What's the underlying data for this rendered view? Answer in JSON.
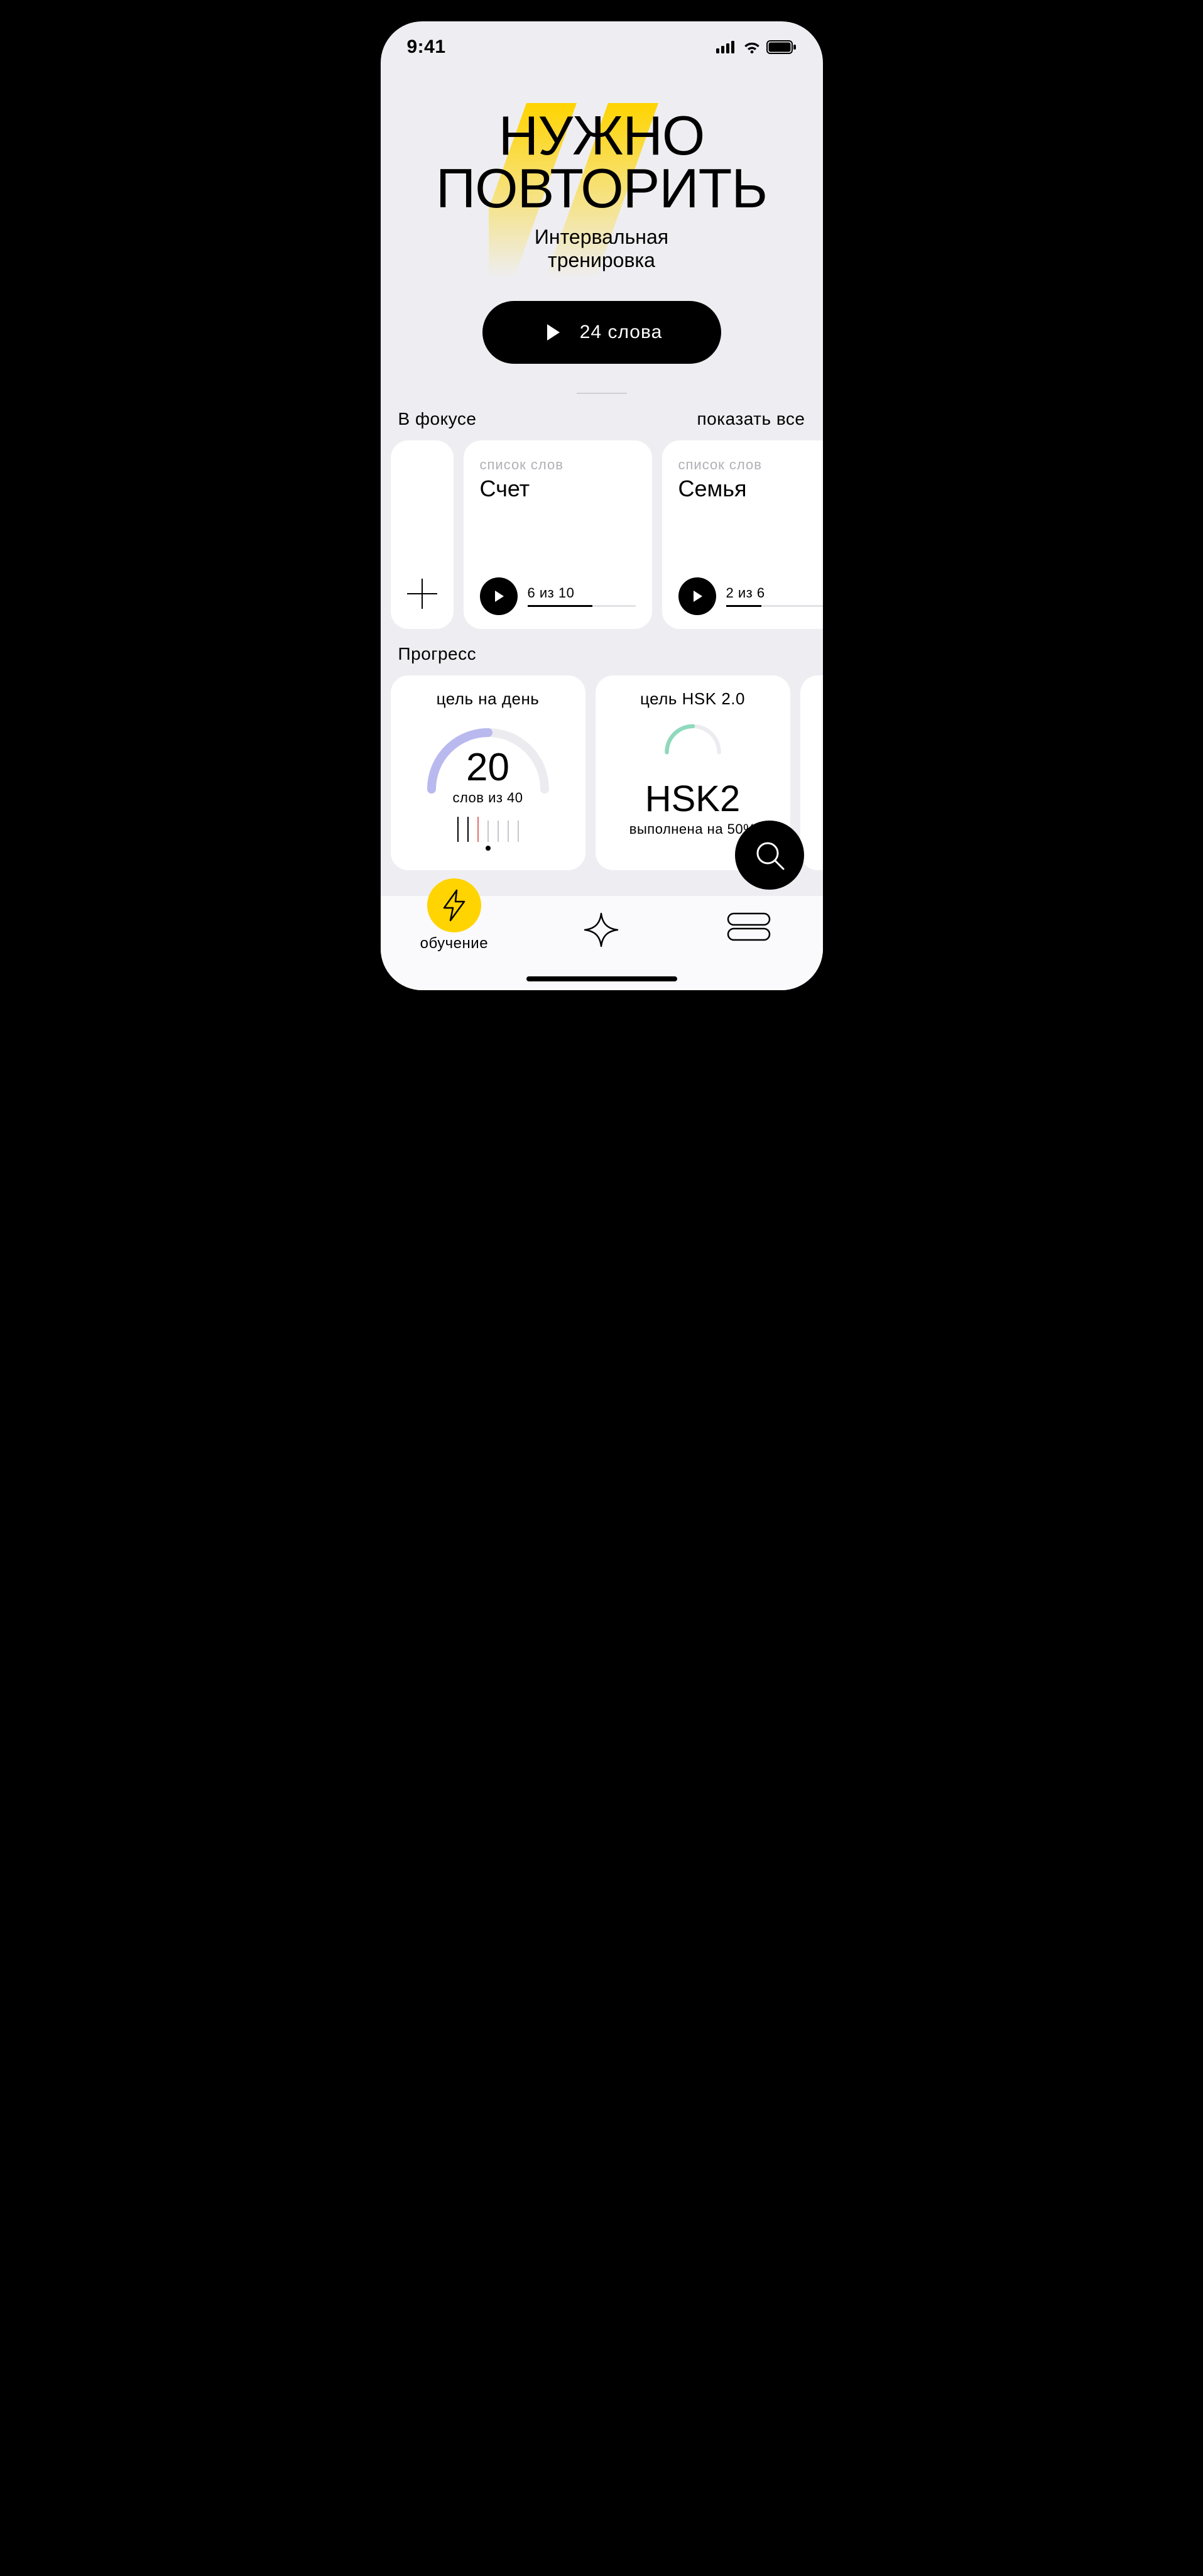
{
  "status": {
    "time": "9:41"
  },
  "hero": {
    "title_line1": "нужно",
    "title_line2": "повторить",
    "subtitle_line1": "Интервальная",
    "subtitle_line2": "тренировка",
    "cta_label": "24 слова"
  },
  "focus": {
    "heading": "В фокусе",
    "show_all": "показать все",
    "eyebrow": "список слов",
    "cards": [
      {
        "title": "Счет",
        "progress_label": "6 из 10",
        "progress_pct": 60
      },
      {
        "title": "Семья",
        "progress_label": "2 из 6",
        "progress_pct": 33
      }
    ]
  },
  "progress": {
    "heading": "Прогресс",
    "daily": {
      "heading": "цель на день",
      "number": "20",
      "sub": "слов из 40",
      "arc_pct": 50,
      "arc_color": "#b9b9ef"
    },
    "hsk": {
      "heading": "цель HSK 2.0",
      "big": "HSK2",
      "sub": "выполнена на 50%",
      "arc_pct": 50,
      "arc_color": "#8fd9bd"
    }
  },
  "tabs": {
    "learn": "обучение"
  }
}
